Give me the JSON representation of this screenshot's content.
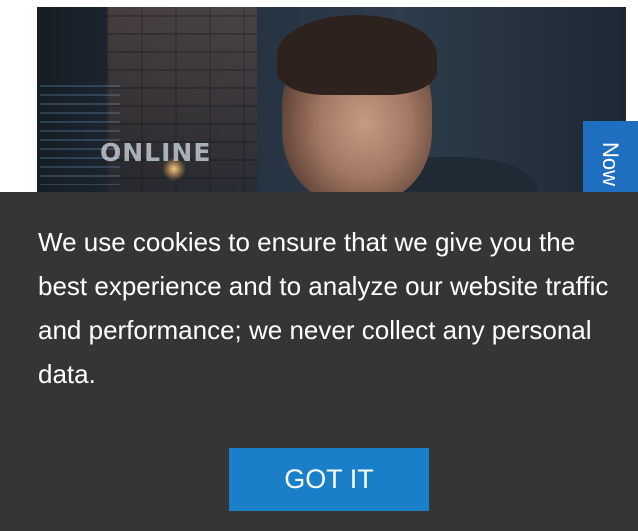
{
  "hero": {
    "image_overlay_text": "ONLINE"
  },
  "side_tab": {
    "label": "Now"
  },
  "cookie_banner": {
    "message": "We use cookies to ensure that we give you the best experience and to analyze our website traffic and performance; we never collect any personal data.",
    "button_label": "GOT IT",
    "background_color": "#353535",
    "button_color": "#1a7fc9"
  },
  "colors": {
    "accent_tab": "#1f6fc0"
  }
}
